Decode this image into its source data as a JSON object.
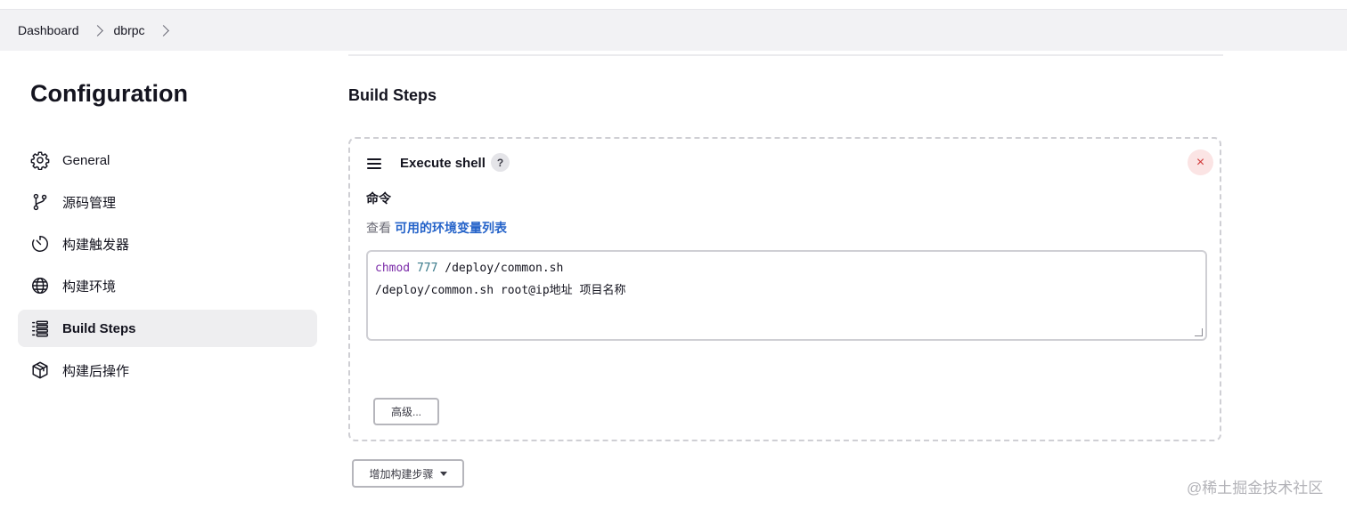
{
  "breadcrumb": {
    "items": [
      "Dashboard",
      "dbrpc"
    ]
  },
  "page": {
    "title": "Configuration"
  },
  "sidebar": {
    "items": [
      {
        "label": "General",
        "icon": "gear-icon",
        "active": false
      },
      {
        "label": "源码管理",
        "icon": "git-branch-icon",
        "active": false
      },
      {
        "label": "构建触发器",
        "icon": "timer-icon",
        "active": false
      },
      {
        "label": "构建环境",
        "icon": "globe-icon",
        "active": false
      },
      {
        "label": "Build Steps",
        "icon": "list-icon",
        "active": true
      },
      {
        "label": "构建后操作",
        "icon": "package-icon",
        "active": false
      }
    ]
  },
  "main": {
    "section_title": "Build Steps",
    "step": {
      "title": "Execute shell",
      "help": "?",
      "close": "×",
      "command_label": "命令",
      "env_prefix": "查看",
      "env_link": "可用的环境变量列表",
      "command_lines": [
        {
          "kw": "chmod",
          "num": "777",
          "rest": "/deploy/common.sh"
        },
        {
          "text": "/deploy/common.sh root@ip地址 项目名称"
        }
      ],
      "advanced_button": "高级..."
    },
    "add_step_button": "增加构建步骤"
  },
  "watermark": "@稀土掘金技术社区",
  "colors": {
    "accent_link": "#2563c9",
    "active_bg": "#eeeef0",
    "close_red": "#d13a3a"
  }
}
